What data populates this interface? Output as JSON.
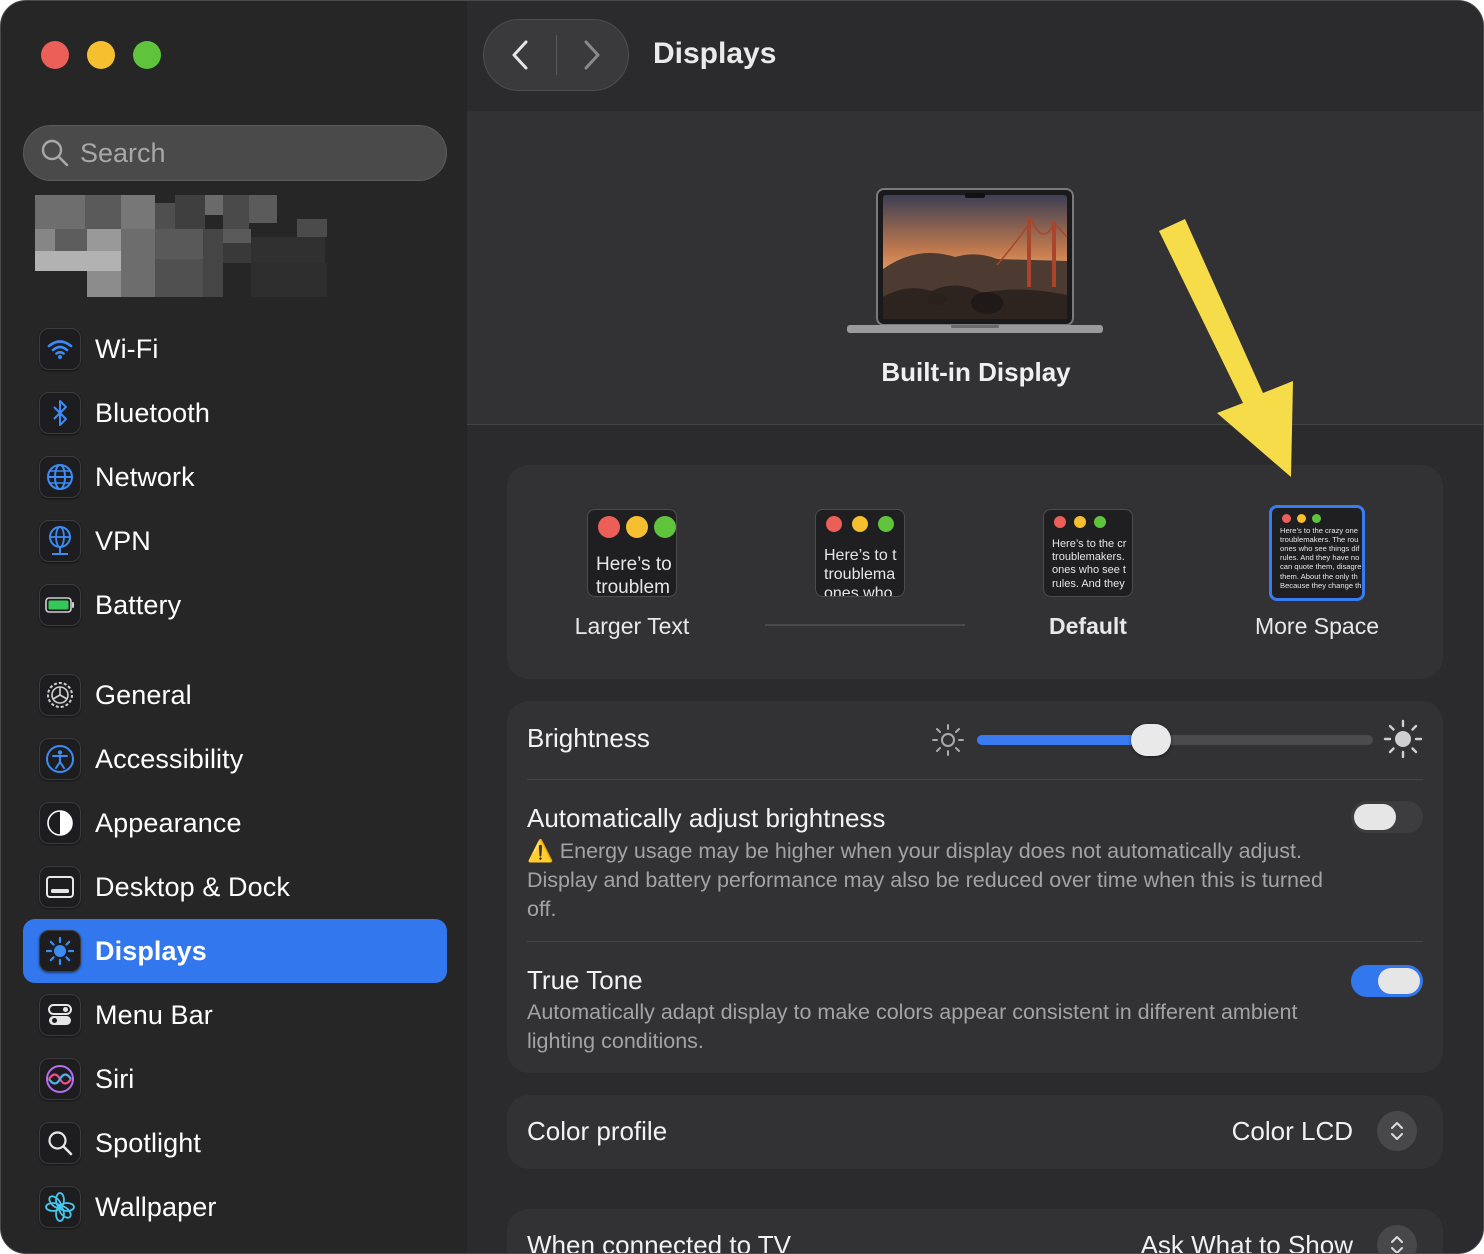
{
  "window": {
    "title": "Displays"
  },
  "search": {
    "placeholder": "Search"
  },
  "sidebar": {
    "items": [
      {
        "label": "Wi-Fi",
        "icon": "wifi-icon"
      },
      {
        "label": "Bluetooth",
        "icon": "bluetooth-icon"
      },
      {
        "label": "Network",
        "icon": "network-globe-icon"
      },
      {
        "label": "VPN",
        "icon": "vpn-globe-icon"
      },
      {
        "label": "Battery",
        "icon": "battery-icon"
      },
      {
        "label": "General",
        "icon": "gear-icon"
      },
      {
        "label": "Accessibility",
        "icon": "accessibility-icon"
      },
      {
        "label": "Appearance",
        "icon": "appearance-icon"
      },
      {
        "label": "Desktop & Dock",
        "icon": "desktop-dock-icon"
      },
      {
        "label": "Displays",
        "icon": "sun-icon",
        "selected": true
      },
      {
        "label": "Menu Bar",
        "icon": "menu-bar-icon"
      },
      {
        "label": "Siri",
        "icon": "siri-icon"
      },
      {
        "label": "Spotlight",
        "icon": "magnifier-icon"
      },
      {
        "label": "Wallpaper",
        "icon": "flower-icon"
      }
    ]
  },
  "display": {
    "name": "Built-in Display"
  },
  "resolution": {
    "options": [
      {
        "label": "Larger Text",
        "preview": "Here’s to\ntroublem"
      },
      {
        "label": "",
        "preview": "Here’s to t\ntroublema\nones who"
      },
      {
        "label": "Default",
        "preview": "Here’s to the cr\ntroublemakers.\nones who see t\nrules. And they"
      },
      {
        "label": "More Space",
        "preview": "Here’s to the crazy one\ntroublemakers. The rou\nones who see things dif\nrules. And they have no\ncan quote them, disagre\nthem. About the only th\nBecause they change th"
      }
    ],
    "selected_index": 3
  },
  "brightness": {
    "label": "Brightness",
    "level": 0.44
  },
  "auto_brightness": {
    "label": "Automatically adjust brightness",
    "warning_icon": "⚠️",
    "description": "Energy usage may be higher when your display does not automatically adjust. Display and battery performance may also be reduced over time when this is turned off.",
    "enabled": false
  },
  "true_tone": {
    "label": "True Tone",
    "description": "Automatically adapt display to make colors appear consistent in different ambient lighting conditions.",
    "enabled": true
  },
  "color_profile": {
    "label": "Color profile",
    "value": "Color LCD"
  },
  "tv": {
    "label": "When connected to TV",
    "value": "Ask What to Show"
  },
  "colors": {
    "accent": "#3377ee",
    "annotation_arrow": "#f7dc4a"
  }
}
